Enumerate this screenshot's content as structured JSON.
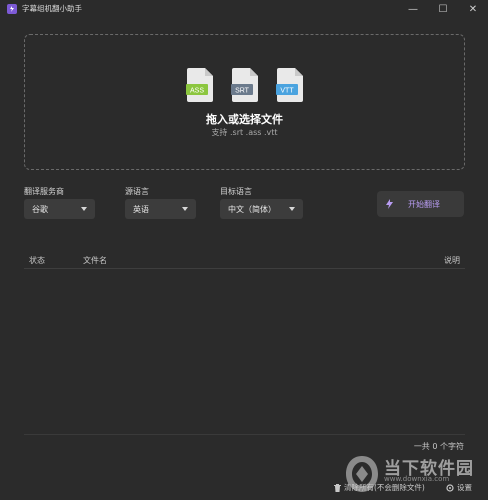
{
  "window": {
    "title": "字幕组机翻小助手",
    "buttons": [
      "minimize",
      "maximize",
      "close"
    ]
  },
  "dropzone": {
    "file_icons": [
      {
        "label": "ASS",
        "color": "#8cc63f"
      },
      {
        "label": "SRT",
        "color": "#6b7a8c"
      },
      {
        "label": "VTT",
        "color": "#4aa3df"
      }
    ],
    "title": "拖入或选择文件",
    "subtitle": "支持 .srt .ass .vtt"
  },
  "options": {
    "service": {
      "label": "翻译服务商",
      "value": "谷歌"
    },
    "source_lang": {
      "label": "源语言",
      "value": "英语"
    },
    "target_lang": {
      "label": "目标语言",
      "value": "中文（简体）"
    }
  },
  "start_button": {
    "label": "开始翻译",
    "accent": "#b89cf2"
  },
  "table": {
    "headers": {
      "status": "状态",
      "filename": "文件名",
      "note": "说明"
    },
    "rows": []
  },
  "footer": {
    "count": "一共 0 个字符",
    "clear_label": "清除所有(不会删除文件)",
    "settings_label": "设置"
  },
  "watermark": {
    "text": "当下软件园",
    "url": "www.downxia.com"
  }
}
